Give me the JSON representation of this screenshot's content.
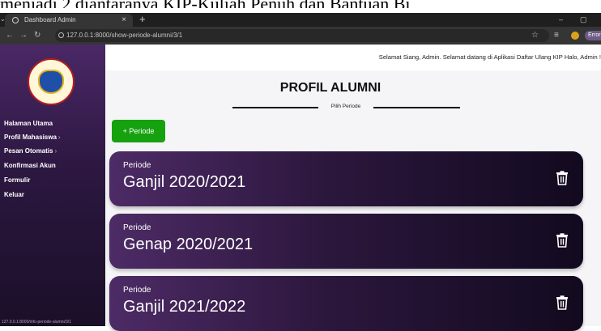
{
  "document_line": "menjadi 2 diantaranya KIP-Kuliah Penuh dan Bantuan Bi",
  "browser": {
    "tab_title": "Dashboard Admin",
    "new_tab": "+",
    "url": "127.0.0.1:8000/show-periode-alumni/3/1",
    "profile_label": "Error"
  },
  "sidebar": {
    "logo_alt": "POLITEKNIK",
    "items": [
      {
        "label": "Halaman Utama",
        "chevron": ""
      },
      {
        "label": "Profil Mahasiswa",
        "chevron": "›"
      },
      {
        "label": "Pesan Otomatis",
        "chevron": "›"
      },
      {
        "label": "Konfirmasi Akun",
        "chevron": ""
      },
      {
        "label": "Formulir",
        "chevron": ""
      },
      {
        "label": "Keluar",
        "chevron": ""
      }
    ],
    "status_url": "127.0.0.1:8000/info-periode-alumni/3/1"
  },
  "topbar": {
    "greeting": "Selamat Siang, Admin. Selamat datang di Aplikasi Daftar Ulang KIP  Halo, Admin !"
  },
  "main": {
    "title": "PROFIL ALUMNI",
    "subtitle": "Pilih Periode",
    "add_button": "+ Periode",
    "periods": [
      {
        "label": "Periode",
        "name": "Ganjil 2020/2021"
      },
      {
        "label": "Periode",
        "name": "Genap 2020/2021"
      },
      {
        "label": "Periode",
        "name": "Ganjil 2021/2022"
      }
    ]
  },
  "colors": {
    "sidebar_top": "#4a2866",
    "card_dark": "#120a1f",
    "add_button": "#16a10f"
  }
}
